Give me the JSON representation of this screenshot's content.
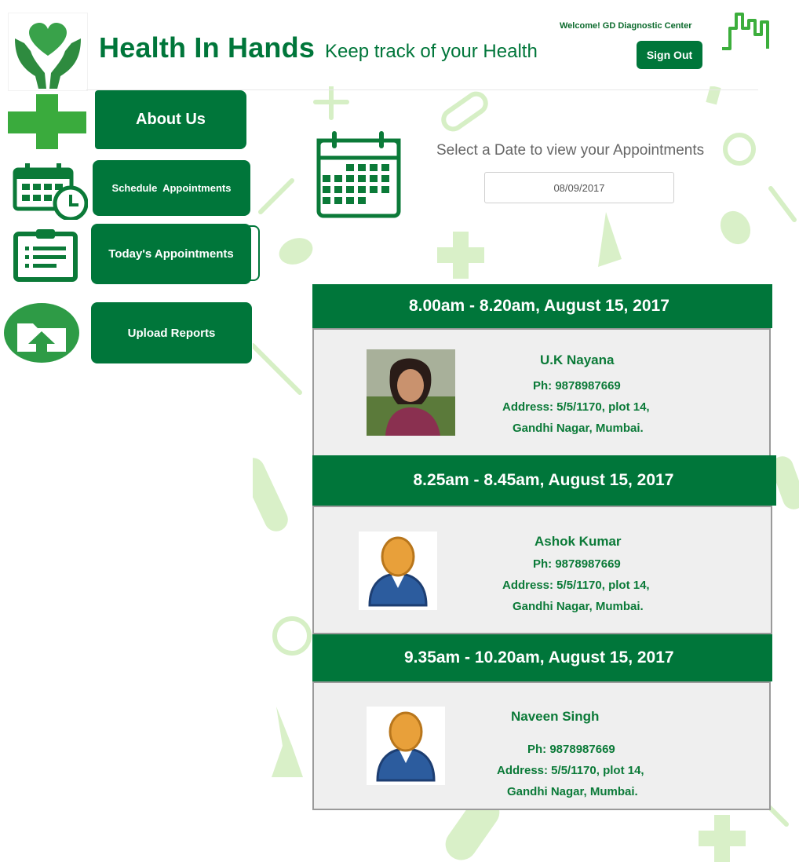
{
  "header": {
    "app_title": "Health In Hands",
    "tagline": "Keep track of your Health",
    "welcome_text": "Welcome! GD Diagnostic Center",
    "sign_out_label": "Sign Out"
  },
  "nav": {
    "about_label": "About Us",
    "schedule_label": "Schedule  Appointments",
    "todays_label": "Today's Appointments",
    "upload_label": "Upload Reports"
  },
  "date_picker": {
    "label": "Select a Date to view your Appointments",
    "value": "08/09/2017"
  },
  "appointments": [
    {
      "time": "8.00am - 8.20am, August 15, 2017",
      "name": "U.K Nayana",
      "phone": "Ph: 9878987669",
      "address_line1": "Address: 5/5/1170, plot 14,",
      "address_line2": "Gandhi Nagar, Mumbai."
    },
    {
      "time": "8.25am - 8.45am, August 15, 2017",
      "name": "Ashok Kumar",
      "phone": "Ph: 9878987669",
      "address_line1": "Address: 5/5/1170, plot 14,",
      "address_line2": "Gandhi Nagar, Mumbai."
    },
    {
      "time": "9.35am - 10.20am, August 15, 2017",
      "name": "Naveen Singh",
      "phone": "Ph: 9878987669",
      "address_line1": "Address: 5/5/1170, plot 14,",
      "address_line2": "Gandhi Nagar, Mumbai."
    }
  ],
  "colors": {
    "brand_green": "#00763a",
    "text_green": "#0b7a38",
    "card_bg": "#efefef"
  },
  "icons": {
    "logo": "heart-hands-icon",
    "city": "city-skyline-icon",
    "about": "medical-cross-icon",
    "schedule": "calendar-clock-icon",
    "todays": "clipboard-icon",
    "upload": "folder-upload-icon",
    "date": "calendar-icon"
  }
}
